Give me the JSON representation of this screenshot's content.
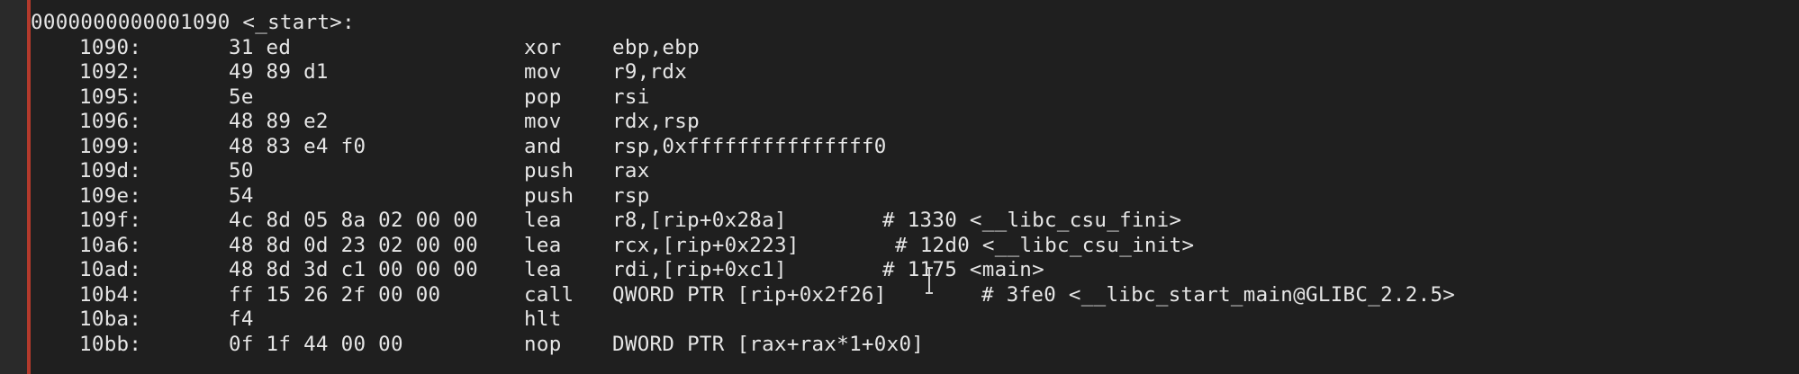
{
  "header": "0000000000001090 <_start>:",
  "rows": [
    {
      "address": "1090:",
      "bytes": "31 ed",
      "mnemonic": "xor",
      "operands": "ebp,ebp",
      "comment": ""
    },
    {
      "address": "1092:",
      "bytes": "49 89 d1",
      "mnemonic": "mov",
      "operands": "r9,rdx",
      "comment": ""
    },
    {
      "address": "1095:",
      "bytes": "5e",
      "mnemonic": "pop",
      "operands": "rsi",
      "comment": ""
    },
    {
      "address": "1096:",
      "bytes": "48 89 e2",
      "mnemonic": "mov",
      "operands": "rdx,rsp",
      "comment": ""
    },
    {
      "address": "1099:",
      "bytes": "48 83 e4 f0",
      "mnemonic": "and",
      "operands": "rsp,0xfffffffffffffff0",
      "comment": ""
    },
    {
      "address": "109d:",
      "bytes": "50",
      "mnemonic": "push",
      "operands": "rax",
      "comment": ""
    },
    {
      "address": "109e:",
      "bytes": "54",
      "mnemonic": "push",
      "operands": "rsp",
      "comment": ""
    },
    {
      "address": "109f:",
      "bytes": "4c 8d 05 8a 02 00 00",
      "mnemonic": "lea",
      "operands": "r8,[rip+0x28a]",
      "comment": "# 1330 <__libc_csu_fini>"
    },
    {
      "address": "10a6:",
      "bytes": "48 8d 0d 23 02 00 00",
      "mnemonic": "lea",
      "operands": "rcx,[rip+0x223]",
      "comment": "# 12d0 <__libc_csu_init>"
    },
    {
      "address": "10ad:",
      "bytes": "48 8d 3d c1 00 00 00",
      "mnemonic": "lea",
      "operands": "rdi,[rip+0xc1]",
      "comment": "# 1175 <main>"
    },
    {
      "address": "10b4:",
      "bytes": "ff 15 26 2f 00 00",
      "mnemonic": "call",
      "operands": "QWORD PTR [rip+0x2f26]",
      "comment": "# 3fe0 <__libc_start_main@GLIBC_2.2.5>"
    },
    {
      "address": "10ba:",
      "bytes": "f4",
      "mnemonic": "hlt",
      "operands": "",
      "comment": ""
    },
    {
      "address": "10bb:",
      "bytes": "0f 1f 44 00 00",
      "mnemonic": "nop",
      "operands": "DWORD PTR [rax+rax*1+0x0]",
      "comment": ""
    }
  ],
  "colors": {
    "background": "#1f1f1f",
    "text": "#e6e6e6",
    "border": "#b33a2c"
  },
  "icons": {
    "cursor": "text-cursor-ibeam-icon"
  }
}
